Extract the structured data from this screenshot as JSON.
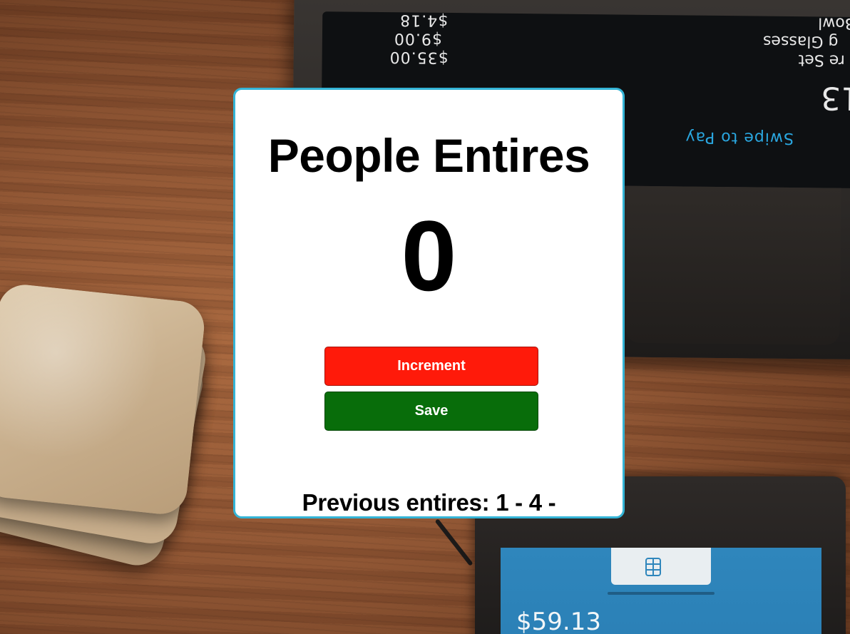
{
  "background": {
    "terminal_screen": {
      "prices": [
        "$4.18",
        "$9.00",
        "$35.00"
      ],
      "items": [
        "Bowl",
        "g Glasses",
        "re Set"
      ],
      "total_fragment": "13",
      "pay_prompt": "Swipe to Pay"
    },
    "card_reader": {
      "amount": "$59.13",
      "chip_icon": "chip-card-icon"
    }
  },
  "card": {
    "title": "People Entires",
    "count": "0",
    "increment_label": "Increment",
    "save_label": "Save",
    "previous_entries": "Previous entires: 1 - 4 -",
    "colors": {
      "border": "#34b4d6",
      "increment": "#ff1a0a",
      "save": "#086d0a"
    }
  }
}
